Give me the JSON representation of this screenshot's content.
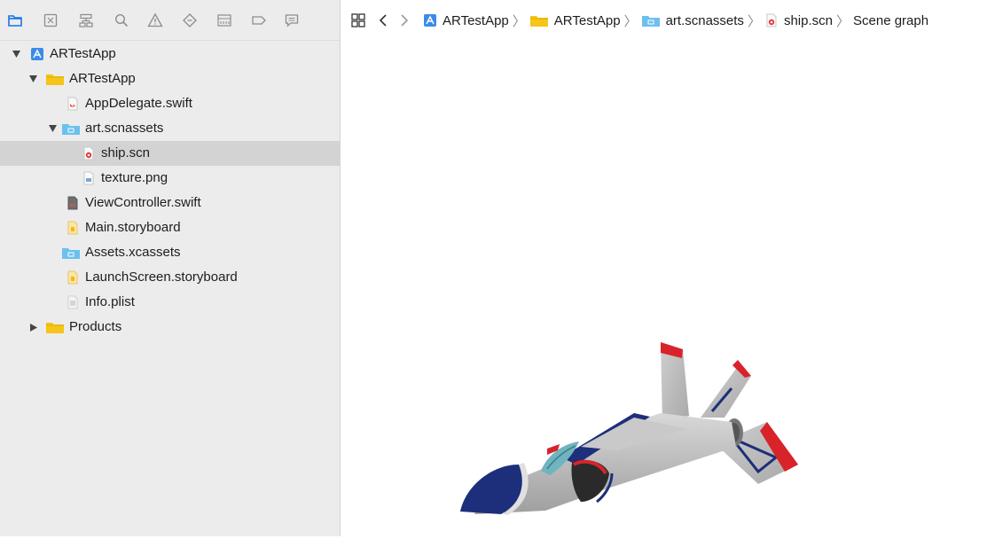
{
  "navigator": {
    "toolbar": [
      {
        "name": "project-navigator",
        "icon": "folder-icon",
        "active": true
      },
      {
        "name": "source-control-navigator",
        "icon": "source-control-icon"
      },
      {
        "name": "symbol-navigator",
        "icon": "hierarchy-icon"
      },
      {
        "name": "find-navigator",
        "icon": "magnifier-icon"
      },
      {
        "name": "issue-navigator",
        "icon": "warning-icon"
      },
      {
        "name": "test-navigator",
        "icon": "diamond-icon"
      },
      {
        "name": "debug-navigator",
        "icon": "gauge-icon"
      },
      {
        "name": "breakpoint-navigator",
        "icon": "breakpoint-icon"
      },
      {
        "name": "report-navigator",
        "icon": "speech-bubble-icon"
      }
    ],
    "tree": [
      {
        "label": "ARTestApp",
        "icon": "project-icon",
        "level": 0,
        "disclosure": "expanded"
      },
      {
        "label": "ARTestApp",
        "icon": "yellow-folder-icon",
        "level": 1,
        "disclosure": "expanded"
      },
      {
        "label": "AppDelegate.swift",
        "icon": "swift-file-icon",
        "level": 2,
        "disclosure": "none"
      },
      {
        "label": "art.scnassets",
        "icon": "blue-folder-icon",
        "level": 2,
        "disclosure": "expanded"
      },
      {
        "label": "ship.scn",
        "icon": "scene-file-icon",
        "level": 3,
        "disclosure": "none",
        "selected": true
      },
      {
        "label": "texture.png",
        "icon": "image-file-icon",
        "level": 3,
        "disclosure": "none"
      },
      {
        "label": "ViewController.swift",
        "icon": "swift-file-icon",
        "level": 2,
        "disclosure": "none"
      },
      {
        "label": "Main.storyboard",
        "icon": "storyboard-file-icon",
        "level": 2,
        "disclosure": "none"
      },
      {
        "label": "Assets.xcassets",
        "icon": "blue-folder-icon",
        "level": 2,
        "disclosure": "none"
      },
      {
        "label": "LaunchScreen.storyboard",
        "icon": "storyboard-file-icon",
        "level": 2,
        "disclosure": "none"
      },
      {
        "label": "Info.plist",
        "icon": "plist-file-icon",
        "level": 2,
        "disclosure": "none"
      },
      {
        "label": "Products",
        "icon": "yellow-folder-icon",
        "level": 0,
        "disclosure": "collapsed"
      }
    ]
  },
  "editor": {
    "jumpbar": {
      "grid_icon": "related-items-grid-icon",
      "back_icon": "chevron-left-icon",
      "forward_icon": "chevron-right-icon",
      "crumbs": [
        {
          "label": "ARTestApp",
          "icon": "project-icon"
        },
        {
          "label": "ARTestApp",
          "icon": "yellow-folder-icon"
        },
        {
          "label": "art.scnassets",
          "icon": "blue-folder-icon"
        },
        {
          "label": "ship.scn",
          "icon": "scene-file-icon"
        },
        {
          "label": "Scene graph",
          "icon": ""
        }
      ]
    },
    "viewport": {
      "content": "3d-ship-model"
    }
  },
  "colors": {
    "accent": "#1a73e8",
    "navigator_bg": "#ececec",
    "selection": "#d3d3d3",
    "folder_yellow": "#f5c518",
    "folder_blue": "#6cc0ee",
    "ship_red": "#d9232b",
    "ship_blue": "#1d2e7a",
    "ship_gray": "#c4c4c4"
  }
}
